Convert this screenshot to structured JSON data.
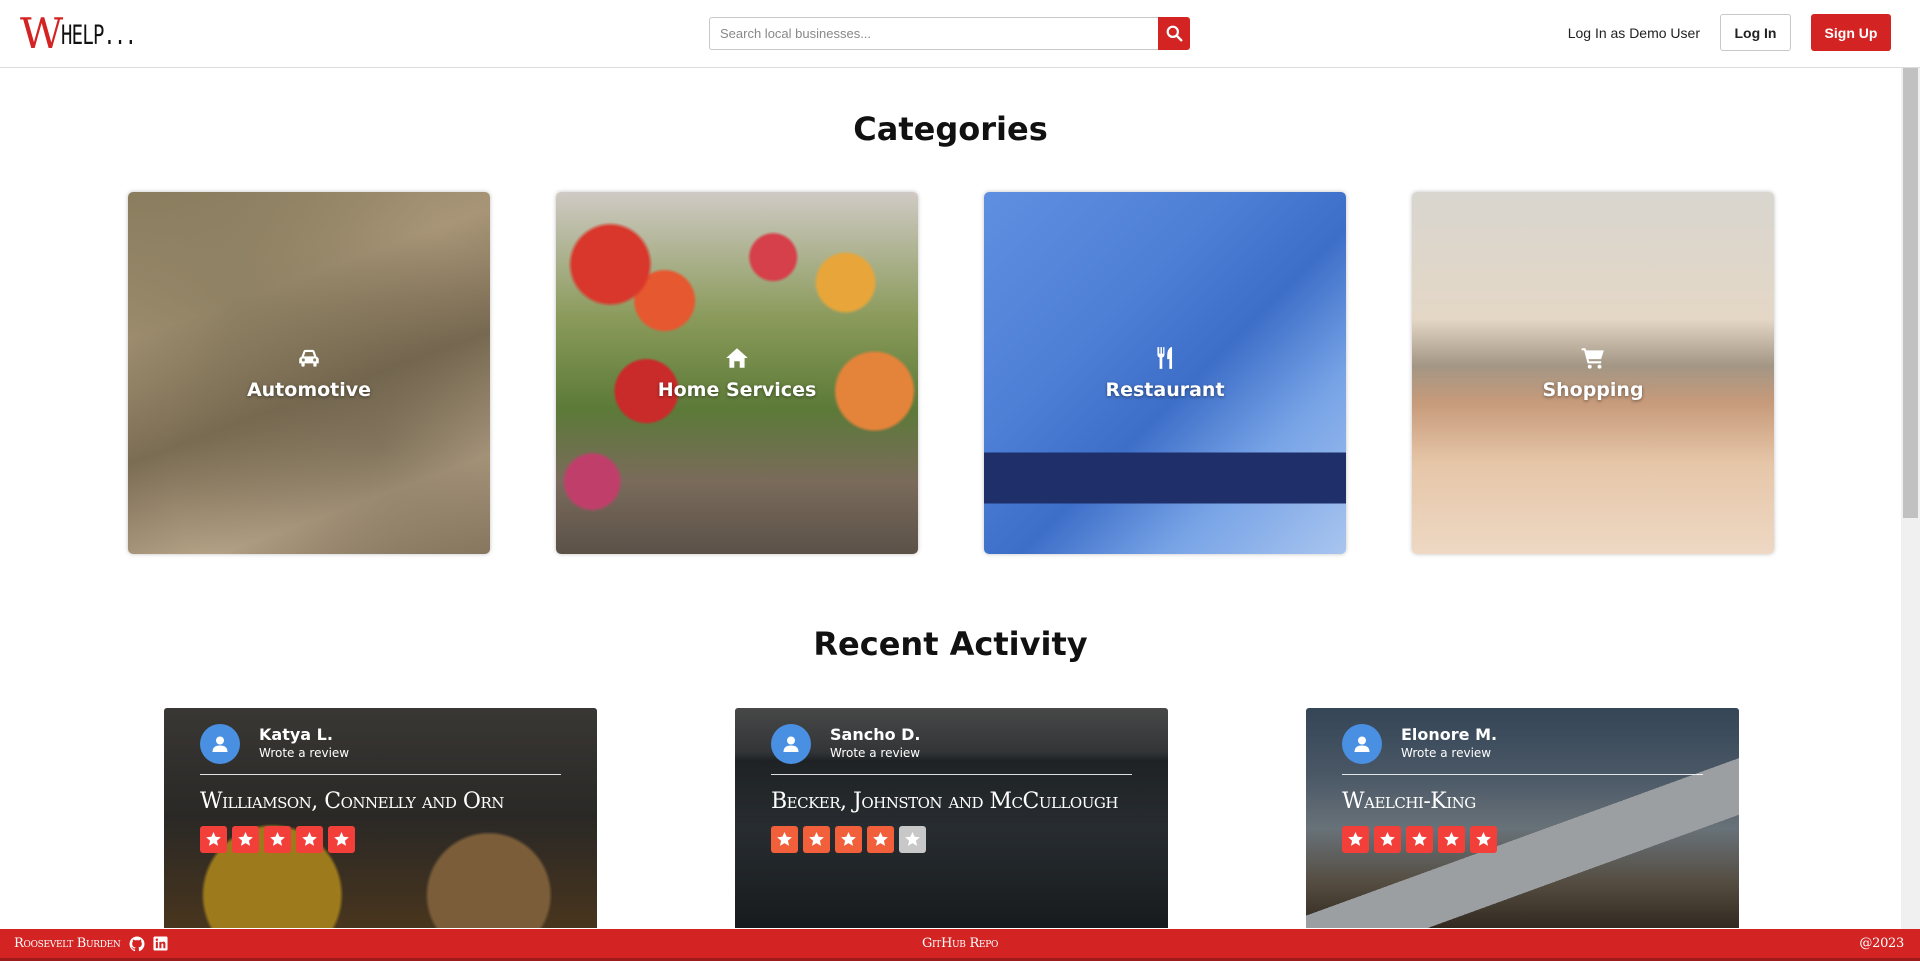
{
  "header": {
    "logo_w": "W",
    "logo_rest": "HELP...",
    "search_placeholder": "Search local businesses...",
    "demo_link": "Log In as Demo User",
    "login_label": "Log In",
    "signup_label": "Sign Up"
  },
  "categories": {
    "title": "Categories",
    "items": [
      {
        "label": "Automotive",
        "icon": "car-icon"
      },
      {
        "label": "Home Services",
        "icon": "home-icon"
      },
      {
        "label": "Restaurant",
        "icon": "utensils-icon"
      },
      {
        "label": "Shopping",
        "icon": "shopping-cart-icon"
      }
    ]
  },
  "recent_activity": {
    "title": "Recent Activity",
    "items": [
      {
        "user": "Katya L.",
        "action": "Wrote a review",
        "business": "Williamson, Connelly and Orn",
        "rating": 5
      },
      {
        "user": "Sancho D.",
        "action": "Wrote a review",
        "business": "Becker, Johnston and McCullough",
        "rating": 4
      },
      {
        "user": "Elonore M.",
        "action": "Wrote a review",
        "business": "Waelchi-King",
        "rating": 5
      }
    ]
  },
  "footer": {
    "author": "Roosevelt Burden",
    "repo_link": "GitHub Repo",
    "copyright": "@2023"
  },
  "colors": {
    "brand_red": "#d32323",
    "star_red": "#f23f3a",
    "avatar_blue": "#4a90e2"
  }
}
